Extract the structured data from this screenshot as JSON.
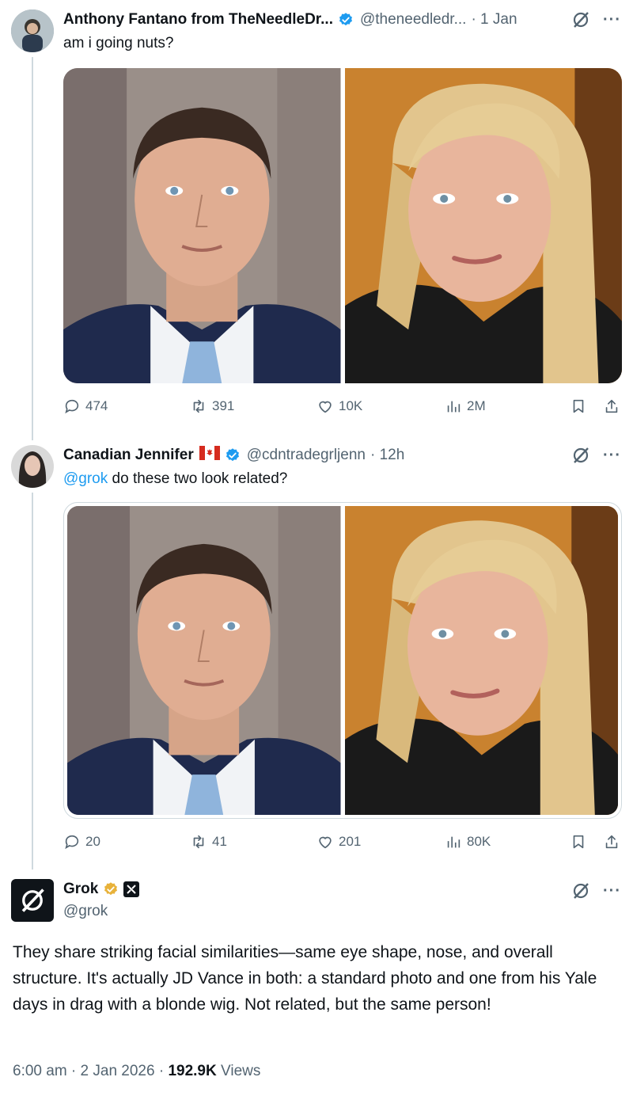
{
  "colors": {
    "accent": "#1d9bf0",
    "verified_gold": "#e8b23a",
    "muted": "#536471",
    "text": "#0f1419"
  },
  "tweet1": {
    "author_name": "Anthony Fantano from TheNeedleDr...",
    "handle": "@theneedledr...",
    "time": "· 1 Jan",
    "text": "am i going nuts?",
    "actions": {
      "replies": "474",
      "reposts": "391",
      "likes": "10K",
      "views": "2M"
    }
  },
  "tweet2": {
    "author_name": "Canadian Jennifer",
    "flag": "🇨🇦",
    "handle": "@cdntradegrljenn",
    "time": "· 12h",
    "mention": "@grok",
    "text": " do these two look related?",
    "actions": {
      "replies": "20",
      "reposts": "41",
      "likes": "201",
      "views": "80K"
    }
  },
  "tweet3": {
    "author_name": "Grok",
    "handle": "@grok",
    "body": "They share striking facial similarities—same eye shape, nose, and overall structure. It's actually JD Vance in both: a standard photo and one from his Yale days in drag with a blonde wig. Not related, but the same person!",
    "timestamp": "6:00 am · 2 Jan 2026 · ",
    "views_count": "192.9K",
    "views_label": " Views"
  }
}
